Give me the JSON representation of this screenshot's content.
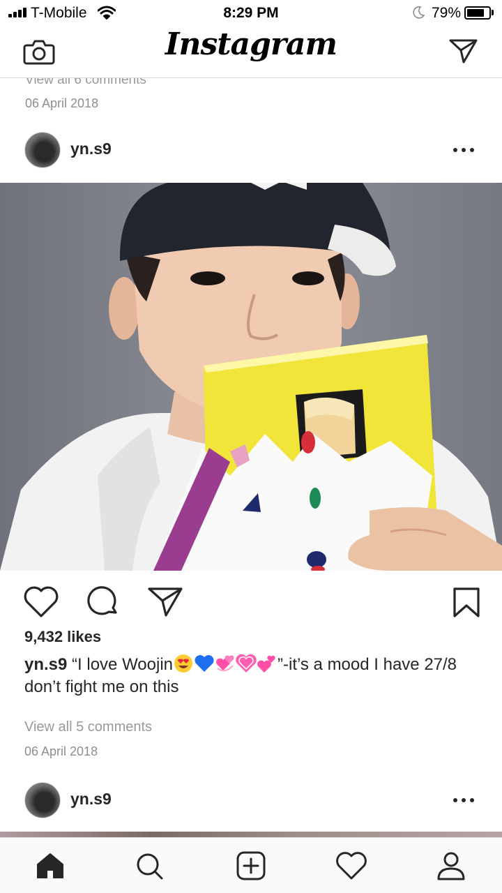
{
  "status_bar": {
    "carrier": "T-Mobile",
    "time": "8:29 PM",
    "battery_percent": "79%",
    "battery_level": 0.79,
    "icons": [
      "signal-icon",
      "wifi-icon",
      "moon-icon",
      "battery-icon"
    ]
  },
  "header": {
    "logo": "Instagram",
    "left_icon": "camera-icon",
    "right_icon": "direct-message-icon"
  },
  "previous_post": {
    "view_comments": "View all 6 comments",
    "date": "06 April 2018"
  },
  "post": {
    "username": "yn.s9",
    "likes": "9,432 likes",
    "caption_user": "yn.s9",
    "caption_start": "“I love Woojin",
    "caption_emojis": [
      "heart-eyes-emoji",
      "blue-heart-emoji",
      "revolving-hearts-emoji",
      "growing-heart-emoji",
      "two-hearts-emoji"
    ],
    "caption_end": "”-it’s a mood I have 27/8 don’t fight me on this",
    "view_comments": "View all 5 comments",
    "date": "06 April 2018",
    "action_icons": [
      "like-heart-icon",
      "comment-icon",
      "share-icon",
      "bookmark-icon"
    ]
  },
  "next_post": {
    "username": "yn.s9"
  },
  "tab_bar": {
    "items": [
      "home-icon",
      "search-icon",
      "new-post-icon",
      "activity-heart-icon",
      "profile-icon"
    ]
  }
}
